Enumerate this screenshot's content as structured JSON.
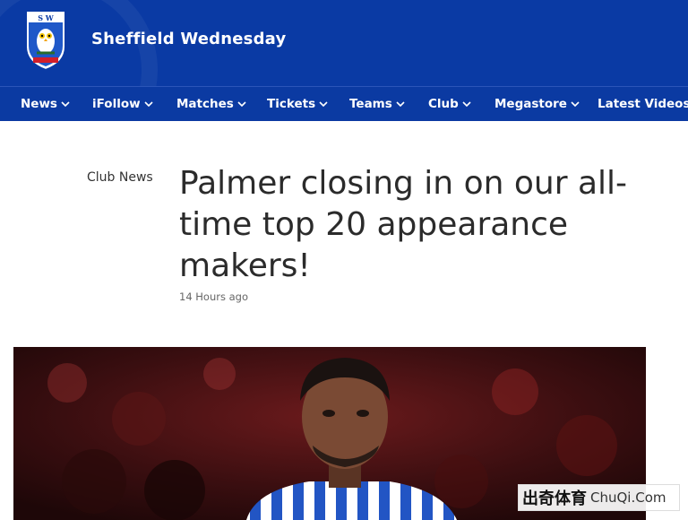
{
  "header": {
    "club_name": "Sheffield Wednesday",
    "crest_icon": "owl-crest-icon",
    "background_color": "#0a3aa4"
  },
  "nav": {
    "items": [
      {
        "label": "News",
        "dropdown": true
      },
      {
        "label": "iFollow",
        "dropdown": true
      },
      {
        "label": "Matches",
        "dropdown": true
      },
      {
        "label": "Tickets",
        "dropdown": true
      },
      {
        "label": "Teams",
        "dropdown": true
      },
      {
        "label": "Club",
        "dropdown": true
      },
      {
        "label": "Megastore",
        "dropdown": true
      },
      {
        "label": "Latest Videos",
        "dropdown": false
      }
    ]
  },
  "article": {
    "category": "Club News",
    "title": "Palmer closing in on our all-time top 20 appearance makers!",
    "time_ago": "14 Hours ago"
  },
  "watermark": {
    "brand_cn": "出奇体育",
    "brand_en": "ChuQi.Com"
  }
}
